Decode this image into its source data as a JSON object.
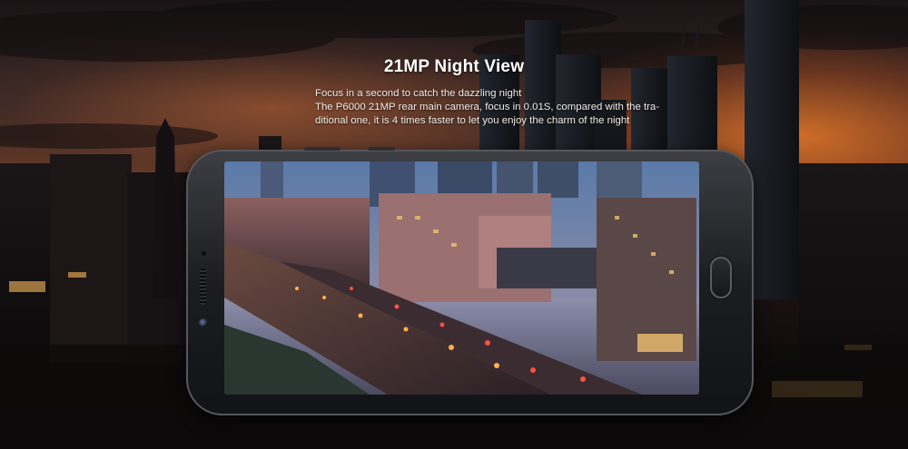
{
  "headline": "21MP Night View",
  "description": {
    "line1": "Focus in a second to catch the dazzling night",
    "line2": "The P6000 21MP rear main camera, focus in 0.01S, compared with the tra-",
    "line3": "ditional one, it is 4 times faster to let you enjoy the charm of the night"
  },
  "colors": {
    "sunset": "#e07a30",
    "text": "#ffffff",
    "phone_body": "#1c1d21"
  },
  "icons": {
    "front_camera": "camera-icon",
    "fingerprint": "fingerprint-icon"
  }
}
